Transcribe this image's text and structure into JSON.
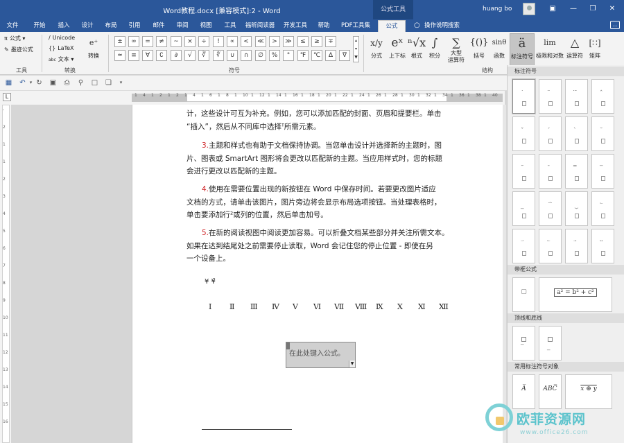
{
  "title_bar": {
    "document_title": "Word教程.docx [兼容模式]:2  -  Word",
    "contextual_tab_group": "公式工具",
    "user_name": "huang bo",
    "buttons": {
      "ribbon_display": "▣",
      "minimize": "—",
      "restore": "❒",
      "close": "✕"
    }
  },
  "tabs": {
    "items": [
      "文件",
      "开始",
      "插入",
      "设计",
      "布局",
      "引用",
      "邮件",
      "审阅",
      "视图",
      "工具",
      "福昕阅读器",
      "开发工具",
      "帮助",
      "PDF工具集",
      "公式"
    ],
    "active": "公式",
    "tell_me": "操作说明搜索"
  },
  "ribbon": {
    "tools_group": {
      "label": "工具",
      "equation": "公式",
      "ink_equation": "墨迹公式"
    },
    "convert_group": {
      "label": "转换",
      "unicode": "Unicode",
      "latex": "LaTeX",
      "text": "文本",
      "abc_prefix": "abc",
      "convert_button": "转换"
    },
    "symbols_group": {
      "label": "符号",
      "row1": [
        "±",
        "∞",
        "=",
        "≠",
        "~",
        "×",
        "÷",
        "!",
        "∝",
        "<",
        "≪",
        ">",
        "≫",
        "≤",
        "≥",
        "∓"
      ],
      "row2": [
        "≈",
        "≡",
        "∀",
        "∁",
        "∂",
        "√",
        "∛",
        "∜",
        "∪",
        "∩",
        "∅",
        "%",
        "°",
        "℉",
        "℃",
        "∆"
      ],
      "more_symbol": "∇"
    },
    "structures_group": {
      "label": "结构",
      "buttons": [
        {
          "glyph": "x/y",
          "label": "分式"
        },
        {
          "glyph": "eˣ",
          "label": "上下标"
        },
        {
          "glyph": "ⁿ√x",
          "label": "根式"
        },
        {
          "glyph": "∫",
          "label": "积分"
        },
        {
          "glyph": "∑",
          "label": "大型\n运算符"
        },
        {
          "glyph": "{()}",
          "label": "括号"
        },
        {
          "glyph": "sinθ",
          "label": "函数"
        },
        {
          "glyph": "ä",
          "label": "标注符号"
        },
        {
          "glyph": "lim",
          "label": "极限和对数"
        },
        {
          "glyph": "△",
          "label": "运算符"
        },
        {
          "glyph": "[∷]",
          "label": "矩阵"
        }
      ]
    }
  },
  "ruler": {
    "numbers": [
      "1",
      "4",
      "1",
      "2",
      "1",
      "2",
      "1",
      "4",
      "1",
      "6",
      "1",
      "8",
      "1",
      "10",
      "1",
      "12",
      "1",
      "14",
      "1",
      "16",
      "1",
      "18",
      "1",
      "20",
      "1",
      "22",
      "1",
      "24",
      "1",
      "26",
      "1",
      "28",
      "1",
      "30",
      "1",
      "32",
      "1",
      "34",
      "1",
      "36",
      "1",
      "38",
      "1",
      "40"
    ],
    "vertical_numbers": [
      "-",
      "2",
      "1",
      "1",
      "2",
      "3",
      "4",
      "5",
      "6",
      "7",
      "8",
      "9",
      "10",
      "11",
      "12",
      "13",
      "14",
      "15",
      "16"
    ]
  },
  "document": {
    "paragraphs": [
      {
        "number": "",
        "text": "计，这些设计可互为补充。例如，您可以添加匹配的封面、页眉和提要栏。单击\n“插入”，然后从不同库中选择ᵀ所需元素。"
      },
      {
        "number": "3.",
        "text": "主题和样式也有助于文档保持协调。当您单击设计并选择新的主题时，图\n片、图表或 SmartArt 图形将会更改以匹配新的主题。当应用样式时，您的标题\n会进行更改以匹配新的主题。"
      },
      {
        "number": "4.",
        "text": "使用在需要位置出现的新按钮在 Word 中保存时间。若要更改图片适应\n文档的方式，请单击该图片，图片旁边将会显示布局选项按钮。当处理表格时，\n单击要添加行²或列的位置，然后单击加号。"
      },
      {
        "number": "5.",
        "text": "在新的阅读视图中阅读更加容易。可以折叠文档某些部分并关注所需文本。\n如果在达到结尾处之前需要停止读取，Word 会记住您的停止位置 - 即使在另\n一个设备上。"
      }
    ],
    "yen_line": "¥  ¥̄",
    "roman_numerals": [
      "Ⅰ",
      "Ⅱ",
      "Ⅲ",
      "Ⅳ",
      "Ⅴ",
      "Ⅵ",
      "Ⅶ",
      "Ⅷ",
      "Ⅸ",
      "Ⅹ",
      "Ⅺ",
      "Ⅻ"
    ],
    "equation_placeholder": "在此处键入公式。"
  },
  "accent_panel": {
    "title": "标注符号",
    "accent_tiles": [
      "̇",
      "̈",
      "⃛",
      "̂",
      "̌",
      "́",
      "̀",
      "̆",
      "̃",
      "̄",
      "̿",
      "̅",
      "̲",
      "⏞",
      "⏟",
      "⃐",
      "⃑",
      "⃖",
      "⃗",
      "⃡"
    ],
    "boxed_title": "带框公式",
    "boxed_tiles": [
      "▢"
    ],
    "boxed_example": "a² = b² + c²",
    "overbar_title": "顶线和底线",
    "overbar_tiles": [
      "̅",
      "̲"
    ],
    "common_title": "常用标注符号对象",
    "common_tiles": [
      "A̅",
      "ABC̅"
    ],
    "common_example": "x ⊕ y"
  },
  "watermark": {
    "text": "欧菲资源网",
    "url": "www.office26.com"
  }
}
